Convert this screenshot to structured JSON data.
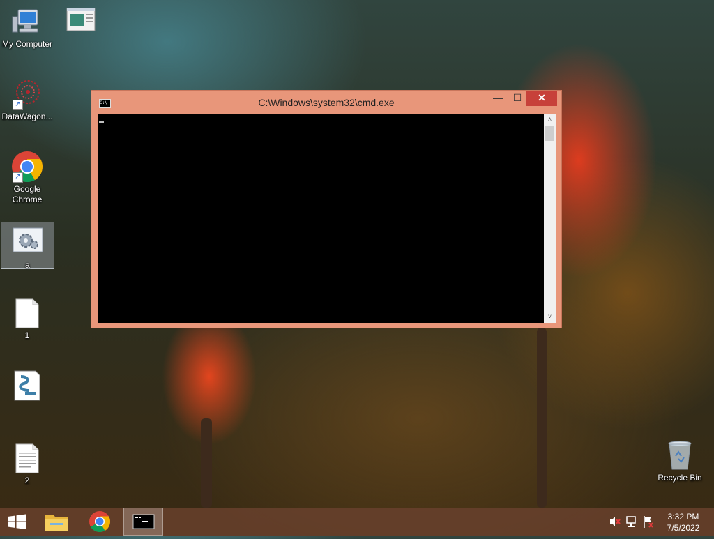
{
  "desktop": {
    "icons": [
      {
        "label": "My Computer"
      },
      {
        "label": ""
      },
      {
        "label": "DataWagon..."
      },
      {
        "label": "Google Chrome"
      },
      {
        "label": "a"
      },
      {
        "label": "1"
      },
      {
        "label": ""
      },
      {
        "label": "2"
      },
      {
        "label": "Recycle Bin"
      }
    ]
  },
  "window": {
    "title": "C:\\Windows\\system32\\cmd.exe",
    "minimize_label": "—",
    "maximize_label": "☐",
    "close_label": "✕",
    "scroll_up": "˄",
    "scroll_down": "˅"
  },
  "taskbar": {
    "clock_time": "3:32 PM",
    "clock_date": "7/5/2022"
  },
  "colors": {
    "window_frame": "#e8967a",
    "close_button": "#c7413a",
    "console_bg": "#000000"
  }
}
